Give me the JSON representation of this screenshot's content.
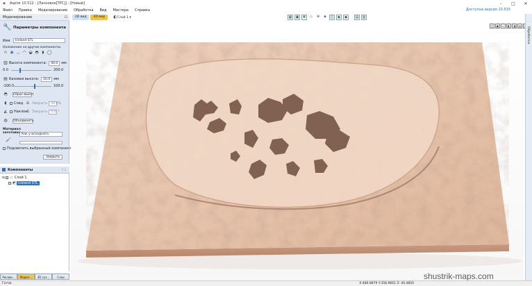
{
  "window": {
    "title": "Aspire 10.512 - [Линзовое[TPC]] - [Новый]",
    "minimize": "–",
    "maximize": "□",
    "close": "✕"
  },
  "menu": {
    "items": [
      "Файл",
      "Правка",
      "Моделирование",
      "Обработка",
      "Вид",
      "Мастера",
      "Справка"
    ],
    "update_notice": "Доступна версия 10.515"
  },
  "panel": {
    "header": "Моделирование",
    "title": "Параметры компонента",
    "name_label": "Имя",
    "name_value": "Iceland STL",
    "overlay_label": "Наложение на другие компоненты",
    "height_label": "Высота компонента:",
    "height_value": "40.0",
    "height_unit": "мм",
    "height_min": "0.0",
    "height_max": "200.0",
    "height_fraction": 0.2,
    "base_label": "Базовая высота:",
    "base_value": "10.0",
    "base_unit": "мм",
    "base_min": "-100.0",
    "base_max": "100.0",
    "base_fraction": 0.55,
    "reset_height": "Сброс высот",
    "fade_label": "След",
    "tilt_label": "Наклон",
    "fade_more": "Закрыть",
    "fade_value": "50.0",
    "fade_unit": "%",
    "tilt_more": "Закрыть",
    "tilt_value": "0.0",
    "tilt_unit": "°",
    "combine_button": "Объединить",
    "material_label": "Материал заготовки",
    "material_value": "Как у исходного",
    "preview_label": "Подсветить выбранный компонент",
    "close_button": "Закрыть"
  },
  "components": {
    "header": "Компоненты",
    "layer": "Слой 1",
    "item": "Iceland STL"
  },
  "bottom_tabs": [
    "Рисова...",
    "Модел...",
    "3D соз...",
    "Слои"
  ],
  "view_tabs": {
    "tab2d": "2D вид",
    "tab3d": "3D вид",
    "layer_dropdown": "Слой 1 ▾"
  },
  "right_strip": "Обработка",
  "status": "X:486.8879 Y:358.9661 Z: 40.4850",
  "status_left": "Готов",
  "watermark": "shustrik-maps.com",
  "colors": {
    "terrain_light": "#e9c7b0",
    "terrain_shadow": "#6e4d3e",
    "accent_tab": "#f2c34a",
    "panel_bg": "#dde6f2"
  }
}
